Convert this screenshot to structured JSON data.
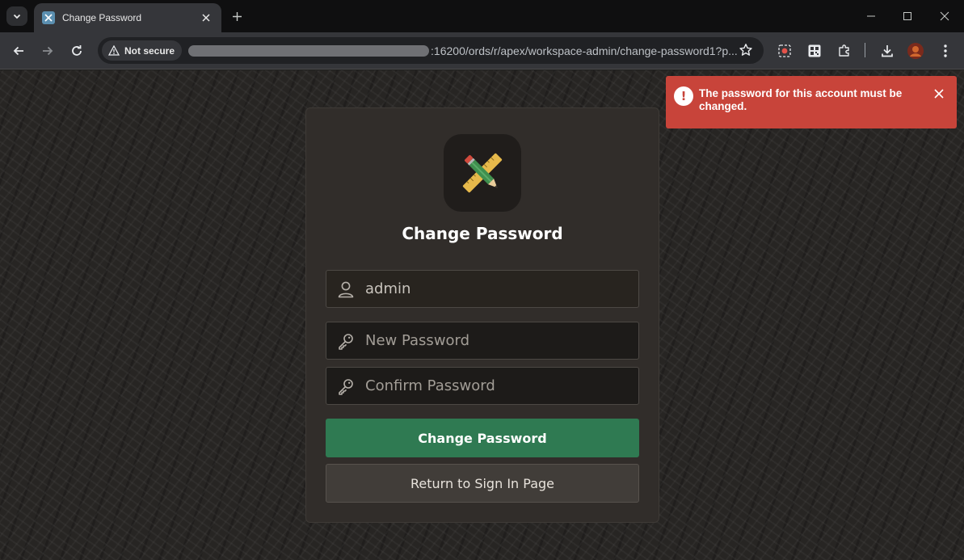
{
  "browser": {
    "tab": {
      "title": "Change Password"
    },
    "address_bar": {
      "security_label": "Not secure",
      "url_visible": ":16200/ords/r/apex/workspace-admin/change-password1?p..."
    }
  },
  "alert": {
    "message": "The password for this account must be changed.",
    "icon": "exclamation-circle-icon",
    "color": "#c8443a"
  },
  "login_card": {
    "title": "Change Password",
    "app_icon": "pencil-ruler-icon",
    "username": {
      "value": "admin",
      "icon": "user-icon"
    },
    "new_password": {
      "placeholder": "New Password",
      "icon": "key-icon"
    },
    "confirm_password": {
      "placeholder": "Confirm Password",
      "icon": "key-icon"
    },
    "submit_label": "Change Password",
    "return_label": "Return to Sign In Page"
  },
  "colors": {
    "primary_button": "#2f7a52",
    "page_background": "#272523",
    "card_background": "#312d2a"
  }
}
